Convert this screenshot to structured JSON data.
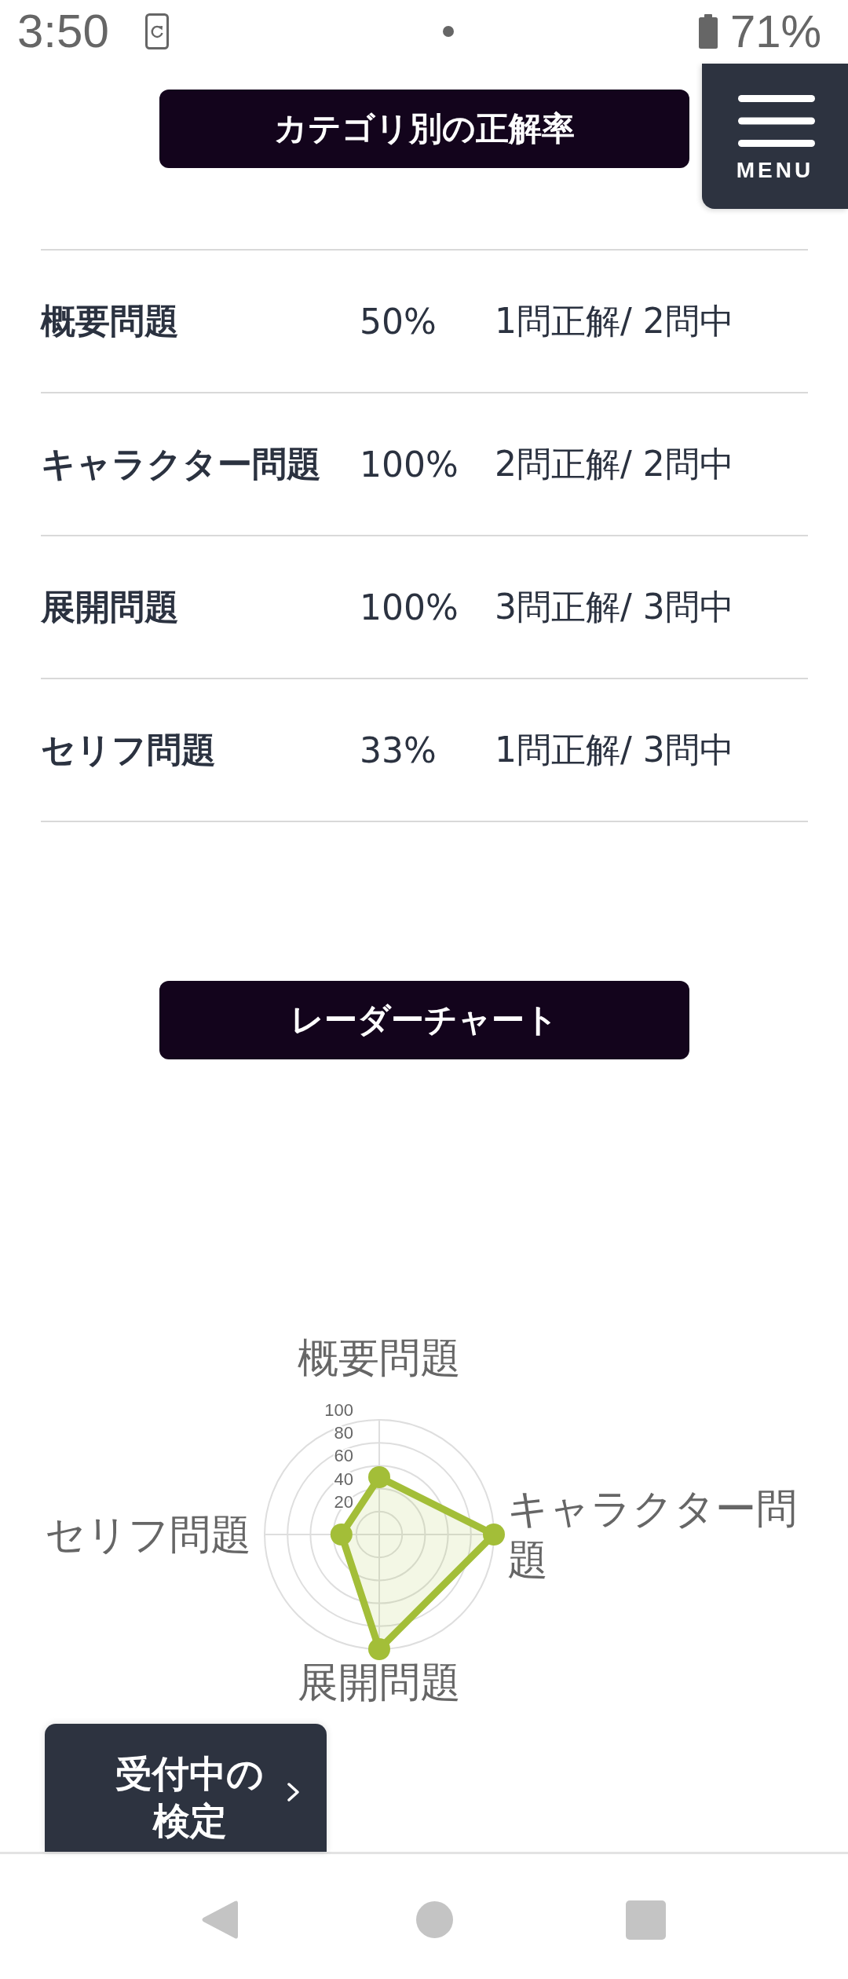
{
  "status_bar": {
    "time": "3:50",
    "battery_percent": "71%"
  },
  "menu_button": {
    "label": "MENU"
  },
  "category_accuracy": {
    "title": "カテゴリ別の正解率",
    "rows": [
      {
        "category": "概要問題",
        "percent": "50%",
        "result": "1問正解/ 2問中"
      },
      {
        "category": "キャラクター問題",
        "percent": "100%",
        "result": "2問正解/ 2問中"
      },
      {
        "category": "展開問題",
        "percent": "100%",
        "result": "3問正解/ 3問中"
      },
      {
        "category": "セリフ問題",
        "percent": "33%",
        "result": "1問正解/ 3問中"
      }
    ]
  },
  "radar_chart": {
    "title": "レーダーチャート",
    "chart_data": {
      "type": "radar",
      "categories": [
        "概要問題",
        "キャラクター問題",
        "展開問題",
        "セリフ問題"
      ],
      "series": [
        {
          "color": "#a3be38",
          "values": [
            50,
            100,
            100,
            33
          ]
        }
      ],
      "ylim": [
        0,
        100
      ],
      "yticks": [
        20,
        40,
        60,
        80,
        100
      ]
    }
  },
  "floating_button": {
    "label": "受付中の検定"
  }
}
